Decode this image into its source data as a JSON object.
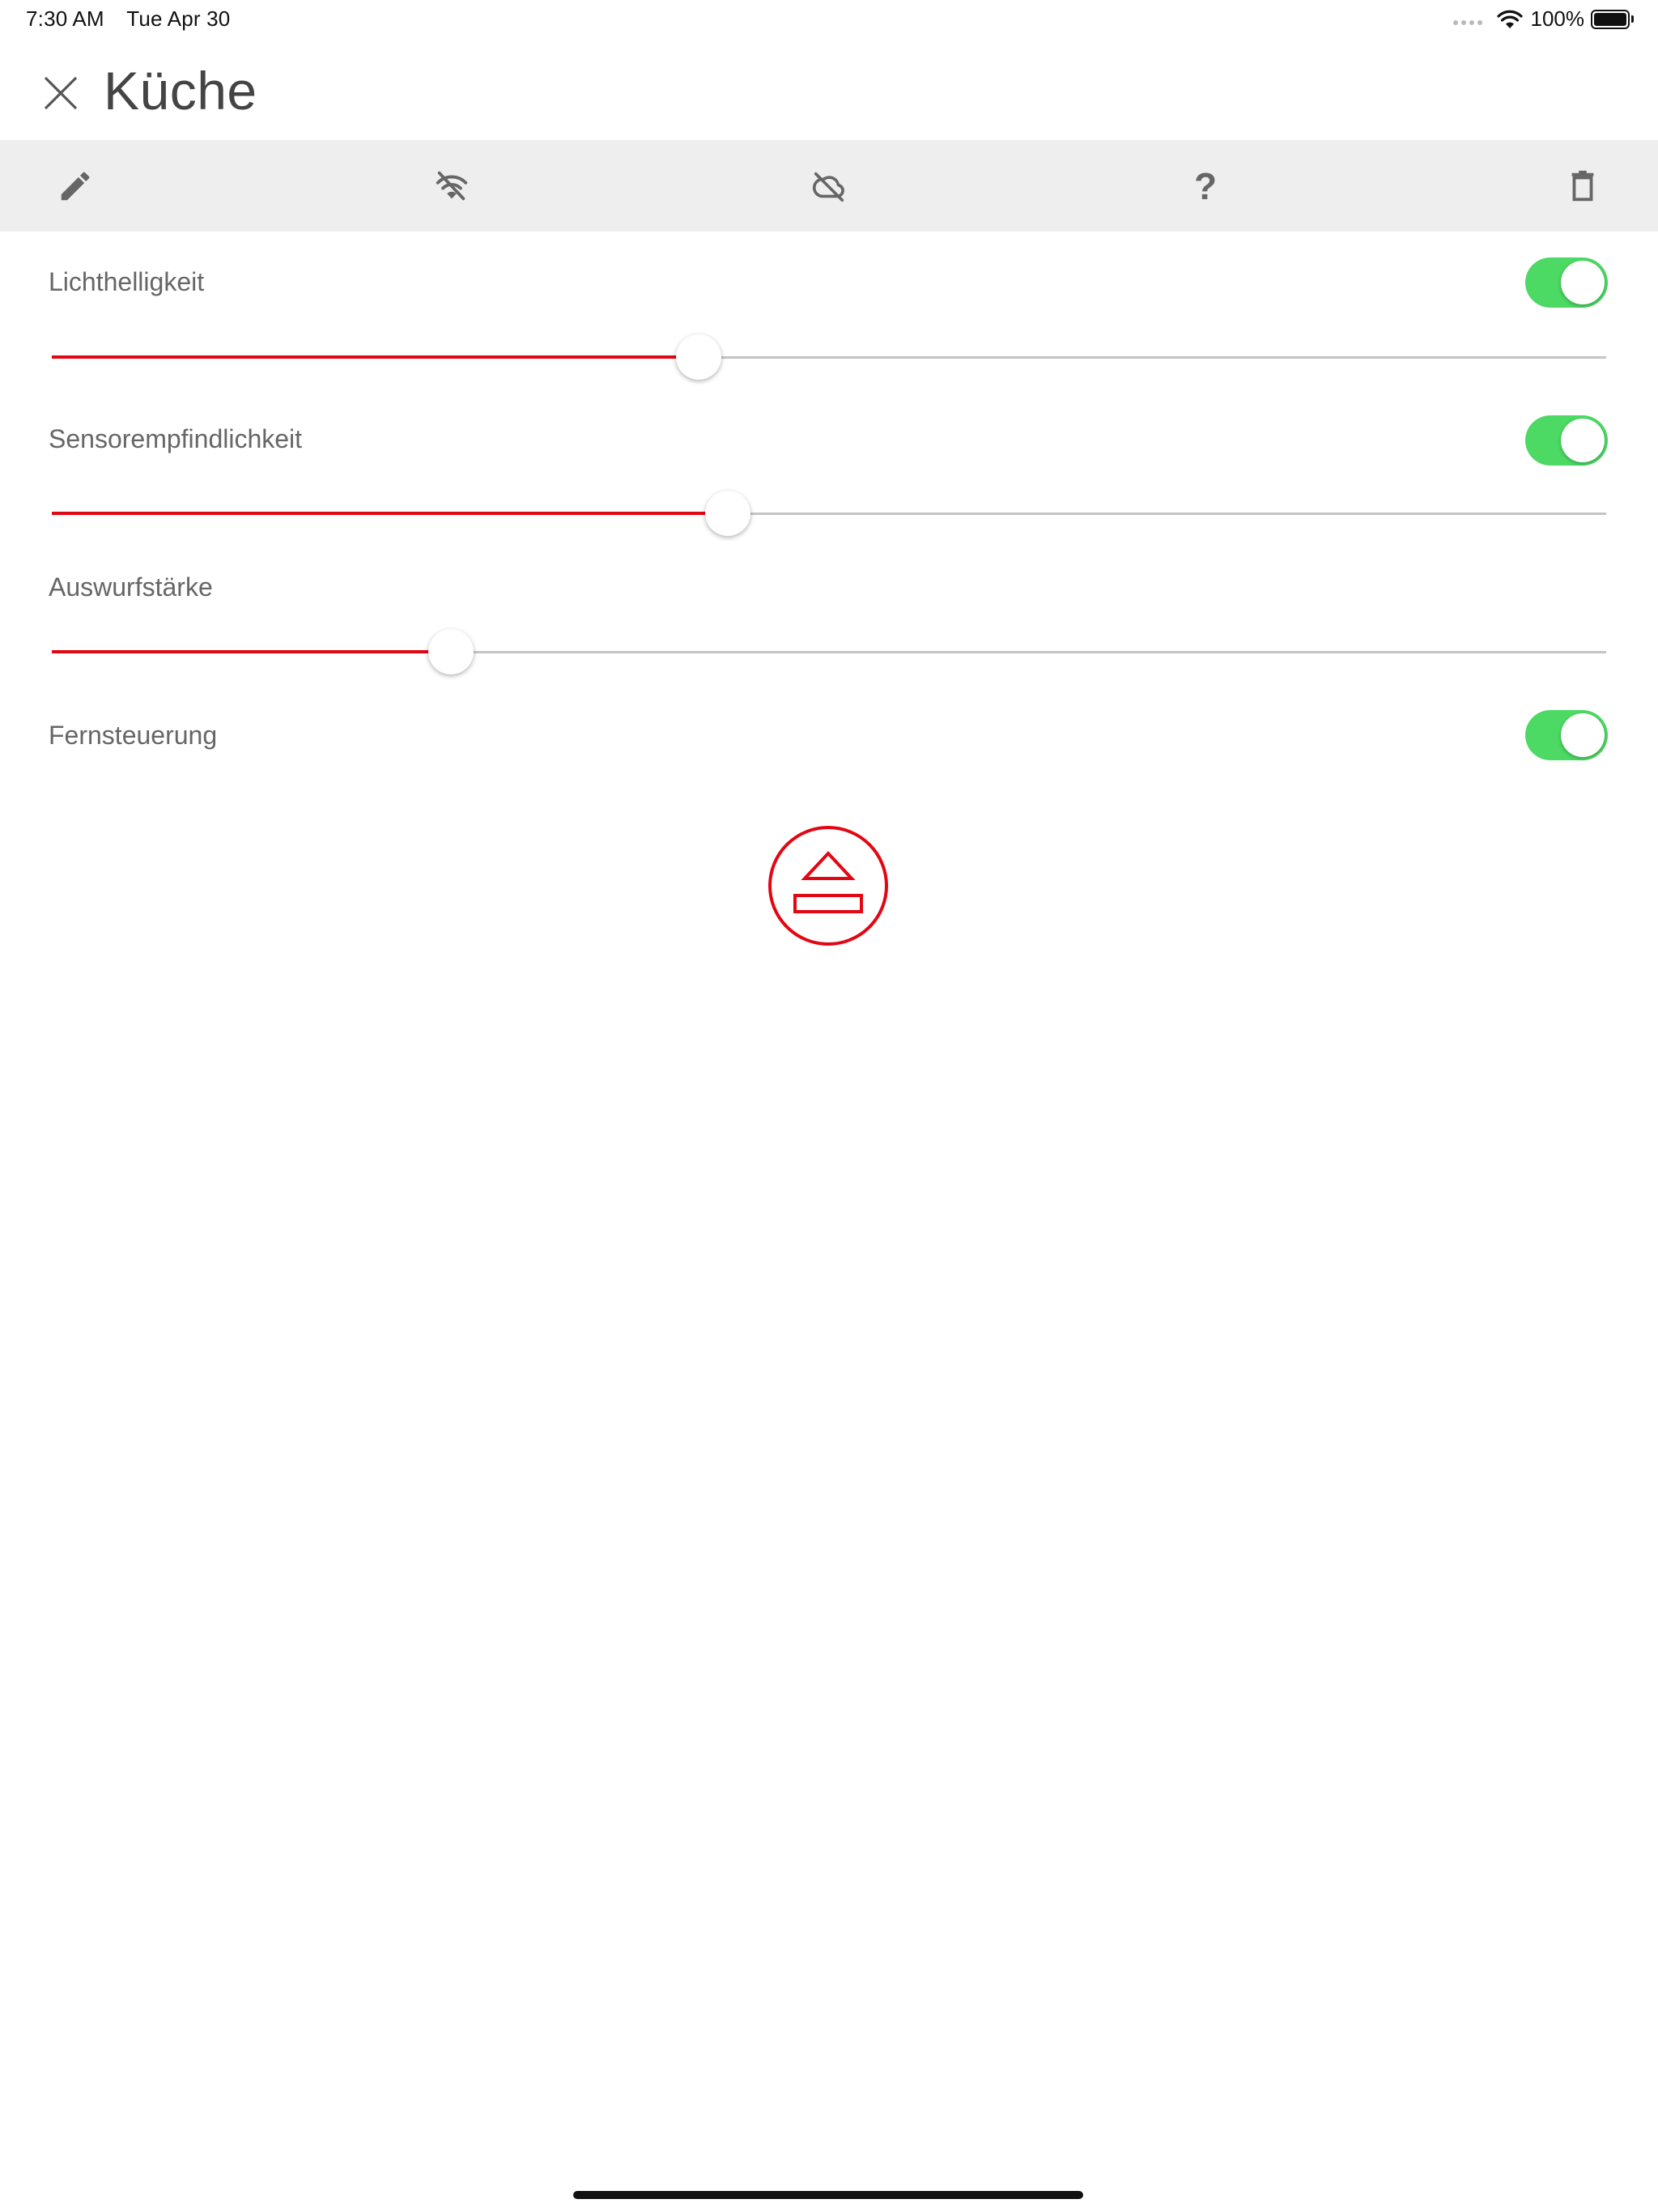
{
  "status_bar": {
    "time": "7:30 AM",
    "date": "Tue Apr 30",
    "battery_percent": "100%",
    "icons": [
      "signal-dots-icon",
      "wifi-icon",
      "battery-icon"
    ]
  },
  "header": {
    "title": "Küche",
    "close_icon": "close-icon"
  },
  "toolbar": {
    "items": [
      {
        "icon": "pencil-icon"
      },
      {
        "icon": "wifi-off-icon"
      },
      {
        "icon": "cloud-off-icon"
      },
      {
        "icon": "help-icon",
        "glyph": "?"
      },
      {
        "icon": "trash-icon"
      }
    ]
  },
  "settings": {
    "light": {
      "label": "Lichthelligkeit",
      "toggle_on": true,
      "value_fraction": 0.416
    },
    "sensor": {
      "label": "Sensorempfindlichkeit",
      "toggle_on": true,
      "value_fraction": 0.435
    },
    "eject_strength": {
      "label": "Auswurfstärke",
      "value_fraction": 0.257
    },
    "remote": {
      "label": "Fernsteuerung",
      "toggle_on": true
    }
  },
  "colors": {
    "accent_red": "#e30613",
    "toggle_green": "#4cd964",
    "toolbar_bg": "#eeeeee"
  },
  "eject_button": {
    "icon": "eject-icon"
  }
}
